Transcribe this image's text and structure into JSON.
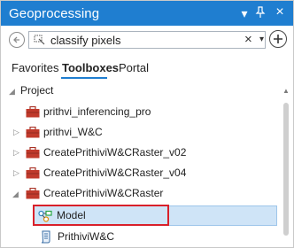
{
  "window": {
    "title": "Geoprocessing"
  },
  "titlebar_buttons": {
    "menu": "▾",
    "pin": "↓",
    "close": "×"
  },
  "search": {
    "value": "classify pixels",
    "clear_icon": "×",
    "dropdown_icon": "▾"
  },
  "tabs": [
    {
      "label": "Favorites",
      "active": false
    },
    {
      "label": "Toolboxes",
      "active": true
    },
    {
      "label": "Portal",
      "active": false
    }
  ],
  "tree": {
    "project_label": "Project",
    "items": [
      {
        "label": "prithvi_inferencing_pro",
        "icon": "toolbox-icon",
        "expandable": false
      },
      {
        "label": "prithvi_W&C",
        "icon": "toolbox-icon",
        "expandable": true
      },
      {
        "label": "CreatePrithiviW&CRaster_v02",
        "icon": "toolbox-icon",
        "expandable": true
      },
      {
        "label": "CreatePrithiviW&CRaster_v04",
        "icon": "toolbox-icon",
        "expandable": true
      },
      {
        "label": "CreatePrithiviW&CRaster",
        "icon": "toolbox-icon",
        "expandable": true,
        "expanded": true
      }
    ],
    "children": [
      {
        "label": "Model",
        "icon": "model-icon",
        "selected": true
      },
      {
        "label": "PrithiviW&C",
        "icon": "script-icon",
        "selected": false
      }
    ]
  },
  "colors": {
    "accent": "#1f7ed0",
    "toolbox": "#c0392b",
    "selection": "#cfe4f7",
    "highlight": "#d9202a"
  }
}
